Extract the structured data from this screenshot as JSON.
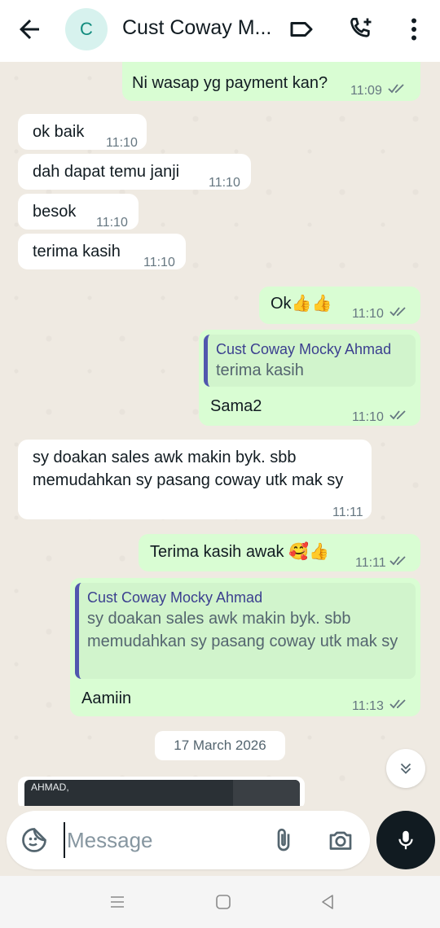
{
  "header": {
    "avatar_letter": "C",
    "contact_name": "Cust Coway M...",
    "icons": [
      "back-arrow-icon",
      "label-icon",
      "add-call-icon",
      "more-vertical-icon"
    ]
  },
  "messages": [
    {
      "dir": "out",
      "text": "Ni wasap yg payment kan?",
      "time": "11:09",
      "read": true
    },
    {
      "dir": "in",
      "text": "ok baik",
      "time": "11:10"
    },
    {
      "dir": "in",
      "text": "dah dapat temu janji",
      "time": "11:10"
    },
    {
      "dir": "in",
      "text": "besok",
      "time": "11:10"
    },
    {
      "dir": "in",
      "text": "terima kasih",
      "time": "11:10"
    },
    {
      "dir": "out",
      "text": "Ok👍👍",
      "time": "11:10",
      "read": true
    },
    {
      "dir": "out",
      "quote_name": "Cust Coway Mocky Ahmad",
      "quote_text": "terima kasih",
      "text": "Sama2",
      "time": "11:10",
      "read": true
    },
    {
      "dir": "in",
      "text": "sy doakan sales awk makin byk. sbb memudahkan sy pasang coway utk mak sy",
      "time": "11:11"
    },
    {
      "dir": "out",
      "text": "Terima kasih awak 🥰👍",
      "time": "11:11",
      "read": true
    },
    {
      "dir": "out",
      "quote_name": "Cust Coway Mocky Ahmad",
      "quote_text": "sy doakan sales awk makin byk. sbb memudahkan sy pasang coway utk mak sy",
      "text": "Aamiin",
      "time": "11:13",
      "read": true
    }
  ],
  "date_separator": "17 March 2026",
  "media_preview_label": "AHMAD,",
  "composer": {
    "placeholder": "Message",
    "icons": [
      "sticker-icon",
      "attach-icon",
      "camera-icon",
      "mic-icon"
    ]
  },
  "navbar": {
    "icons": [
      "recents-icon",
      "home-icon",
      "back-icon"
    ]
  },
  "colors": {
    "outgoing_bubble": "#d9fdd3",
    "incoming_bubble": "#ffffff",
    "chat_background": "#efeae2",
    "read_ticks": "#667781",
    "quote_bar": "#5157ae"
  }
}
